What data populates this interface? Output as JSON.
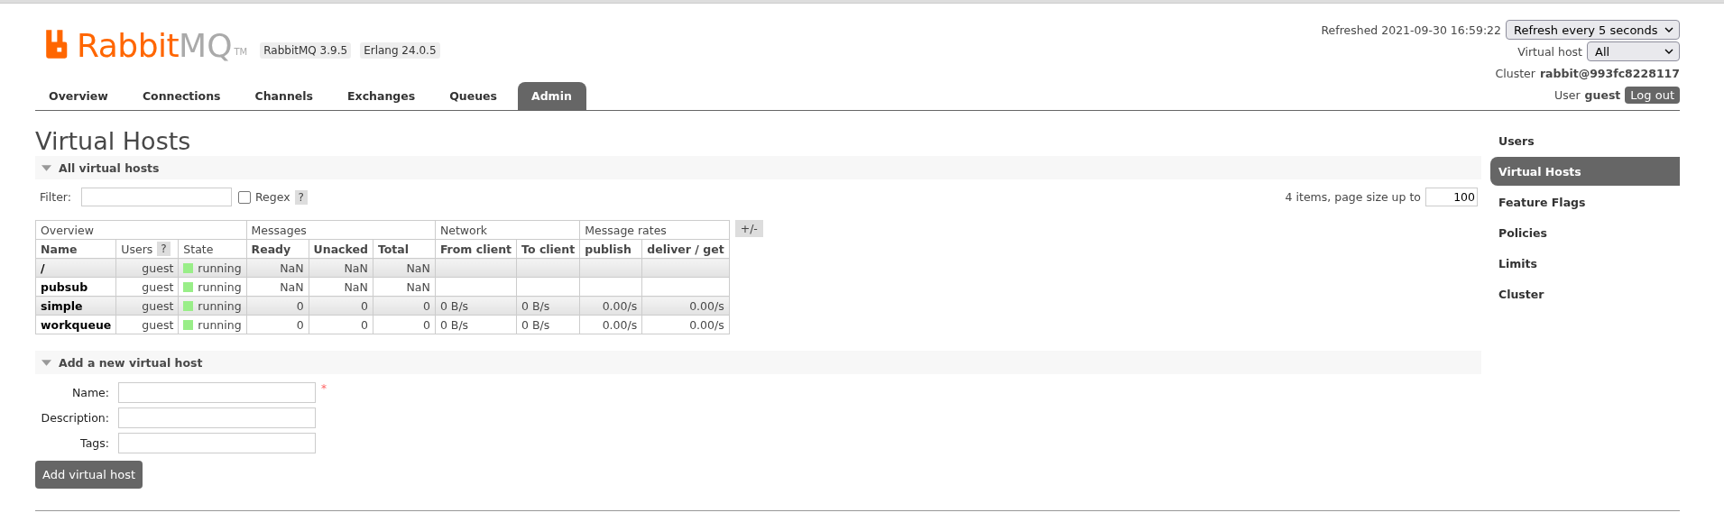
{
  "header": {
    "logo": {
      "primary": "Rabbit",
      "secondary": "MQ",
      "trademark": "TM"
    },
    "versions": [
      "RabbitMQ 3.9.5",
      "Erlang 24.0.5"
    ],
    "refreshed": "Refreshed 2021-09-30 16:59:22",
    "refresh_select": "Refresh every 5 seconds",
    "vhost_label": "Virtual host",
    "vhost_select": "All",
    "cluster_label": "Cluster",
    "cluster_name": "rabbit@993fc8228117",
    "user_label": "User",
    "user_name": "guest",
    "logout": "Log out"
  },
  "tabs": [
    {
      "label": "Overview",
      "selected": false
    },
    {
      "label": "Connections",
      "selected": false
    },
    {
      "label": "Channels",
      "selected": false
    },
    {
      "label": "Exchanges",
      "selected": false
    },
    {
      "label": "Queues",
      "selected": false
    },
    {
      "label": "Admin",
      "selected": true
    }
  ],
  "title": "Virtual Hosts",
  "list_section": {
    "title": "All virtual hosts",
    "expanded": true,
    "filter_label": "Filter:",
    "regex_label": "Regex",
    "regex_checked": false,
    "help": "?",
    "paging_text": "4 items, page size up to",
    "page_size": "100",
    "table": {
      "groups": [
        {
          "label": "Overview",
          "columns": [
            {
              "label": "Name"
            },
            {
              "label": "Users",
              "help": "?"
            },
            {
              "label": "State"
            }
          ]
        },
        {
          "label": "Messages",
          "columns": [
            {
              "label": "Ready"
            },
            {
              "label": "Unacked"
            },
            {
              "label": "Total"
            }
          ]
        },
        {
          "label": "Network",
          "columns": [
            {
              "label": "From client"
            },
            {
              "label": "To client"
            }
          ]
        },
        {
          "label": "Message rates",
          "columns": [
            {
              "label": "publish"
            },
            {
              "label": "deliver / get"
            }
          ]
        }
      ],
      "toggle": "+/-",
      "rows": [
        {
          "name": "/",
          "users": "guest",
          "state": {
            "label": "running",
            "color": "#99ee88"
          },
          "ready": "NaN",
          "unacked": "NaN",
          "total": "NaN"
        },
        {
          "name": "pubsub",
          "users": "guest",
          "state": {
            "label": "running",
            "color": "#99ee88"
          },
          "ready": "NaN",
          "unacked": "NaN",
          "total": "NaN"
        },
        {
          "name": "simple",
          "users": "guest",
          "state": {
            "label": "running",
            "color": "#99ee88"
          },
          "ready": "0",
          "unacked": "0",
          "total": "0",
          "from_client": "0 B/s",
          "to_client": "0 B/s",
          "publish": "0.00/s",
          "deliver_get": "0.00/s"
        },
        {
          "name": "workqueue",
          "users": "guest",
          "state": {
            "label": "running",
            "color": "#99ee88"
          },
          "ready": "0",
          "unacked": "0",
          "total": "0",
          "from_client": "0 B/s",
          "to_client": "0 B/s",
          "publish": "0.00/s",
          "deliver_get": "0.00/s"
        }
      ]
    }
  },
  "add_section": {
    "title": "Add a new virtual host",
    "expanded": true,
    "fields": [
      {
        "label": "Name:",
        "required_mark": "*"
      },
      {
        "label": "Description:"
      },
      {
        "label": "Tags:"
      }
    ],
    "button": "Add virtual host"
  },
  "sidebar": [
    {
      "label": "Users",
      "selected": false
    },
    {
      "label": "Virtual Hosts",
      "selected": true
    },
    {
      "label": "Feature Flags",
      "selected": false
    },
    {
      "label": "Policies",
      "selected": false
    },
    {
      "label": "Limits",
      "selected": false
    },
    {
      "label": "Cluster",
      "selected": false
    }
  ]
}
